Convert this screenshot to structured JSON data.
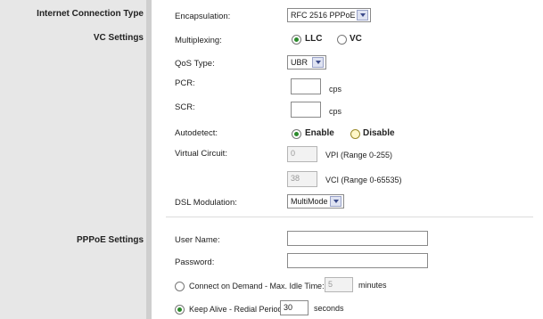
{
  "sections": {
    "internet_connection_type": "Internet Connection Type",
    "vc_settings": "VC Settings",
    "pppoe_settings": "PPPoE Settings"
  },
  "encapsulation": {
    "label": "Encapsulation:",
    "value": "RFC 2516 PPPoE"
  },
  "multiplexing": {
    "label": "Multiplexing:",
    "options": [
      "LLC",
      "VC"
    ],
    "selected": "LLC"
  },
  "qos": {
    "label": "QoS Type:",
    "value": "UBR"
  },
  "pcr": {
    "label": "PCR:",
    "value": "",
    "unit": "cps"
  },
  "scr": {
    "label": "SCR:",
    "value": "",
    "unit": "cps"
  },
  "autodetect": {
    "label": "Autodetect:",
    "options": [
      "Enable",
      "Disable"
    ],
    "selected": "Enable"
  },
  "virtual_circuit": {
    "label": "Virtual Circuit:",
    "vpi_value": "0",
    "vpi_range": "VPI (Range 0-255)",
    "vci_value": "38",
    "vci_range": "VCI (Range 0-65535)"
  },
  "dsl_modulation": {
    "label": "DSL Modulation:",
    "value": "MultiMode"
  },
  "pppoe": {
    "username_label": "User Name:",
    "username_value": "",
    "password_label": "Password:",
    "password_value": "",
    "connect_on_demand_label": "Connect on Demand - Max. Idle Time:",
    "max_idle_value": "5",
    "max_idle_unit": "minutes",
    "keep_alive_label": "Keep Alive - Redial Period:",
    "redial_value": "30",
    "redial_unit": "seconds",
    "selected_mode": "Keep Alive"
  }
}
